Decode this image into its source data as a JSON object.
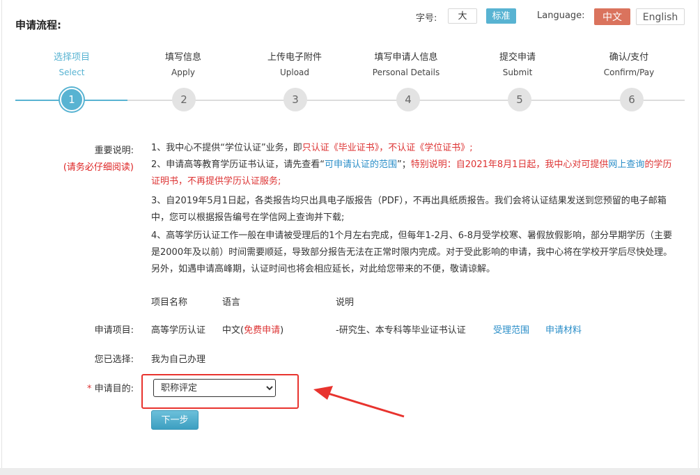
{
  "header": {
    "title": "申请流程:",
    "font_size_label": "字号:",
    "font_large": "大",
    "font_standard": "标准",
    "language_label": "Language:",
    "lang_zh": "中文",
    "lang_en": "English"
  },
  "steps": [
    {
      "title": "选择项目",
      "sub": "Select",
      "num": "1"
    },
    {
      "title": "填写信息",
      "sub": "Apply",
      "num": "2"
    },
    {
      "title": "上传电子附件",
      "sub": "Upload",
      "num": "3"
    },
    {
      "title": "填写申请人信息",
      "sub": "Personal Details",
      "num": "4"
    },
    {
      "title": "提交申请",
      "sub": "Submit",
      "num": "5"
    },
    {
      "title": "确认/支付",
      "sub": "Confirm/Pay",
      "num": "6"
    }
  ],
  "notice": {
    "label": "重要说明:",
    "label_sub": "(请务必仔细阅读)",
    "item1_a": "1、我中心不提供“学位认证”业务，即",
    "item1_b": "只认证《毕业证书》，不认证《学位证书》;",
    "item2_a": "2、申请高等教育学历证书认证，请先查看“",
    "item2_link": "可申请认证的范围",
    "item2_b": "”；",
    "item2_c": "特别说明：自2021年8月1日起，我中心对可提供",
    "item2_link2": "网上查询",
    "item2_d": "的学历证明书，不再提供学历认证服务;",
    "item3": "3、自2019年5月1日起，各类报告均只出具电子版报告（PDF），不再出具纸质报告。我们会将认证结果发送到您预留的电子邮箱中，您可以根据报告编号在学信网上查询并下载;",
    "item4": "4、高等学历认证工作一般在申请被受理后的1个月左右完成，但每年1-2月、6-8月受学校寒、暑假放假影响，部分早期学历（主要是2000年及以前）时间需要顺延，导致部分报告无法在正常时限内完成。对于受此影响的申请，我中心将在学校开学后尽快处理。另外，如遇申请高峰期，认证时间也将会相应延长，对此给您带来的不便，敬请谅解。"
  },
  "table": {
    "col_name": "项目名称",
    "col_lang": "语言",
    "col_desc": "说明",
    "row_label": "申请项目:",
    "project_name": "高等学历认证",
    "lang_a": "中文(",
    "lang_free": "免费申请",
    "lang_b": ")",
    "desc": "-研究生、本专科等毕业证书认证",
    "link_scope": "受理范围",
    "link_materials": "申请材料"
  },
  "selection": {
    "label": "您已选择:",
    "value": "我为自己办理"
  },
  "purpose": {
    "required_mark": "*",
    "label": "申请目的:",
    "selected": "职称评定"
  },
  "next_button": "下一步",
  "colors": {
    "accent": "#58b3d2",
    "lang_active": "#da735d",
    "warning": "#d33",
    "link": "#2a8ec8",
    "highlight": "#e8332e"
  }
}
